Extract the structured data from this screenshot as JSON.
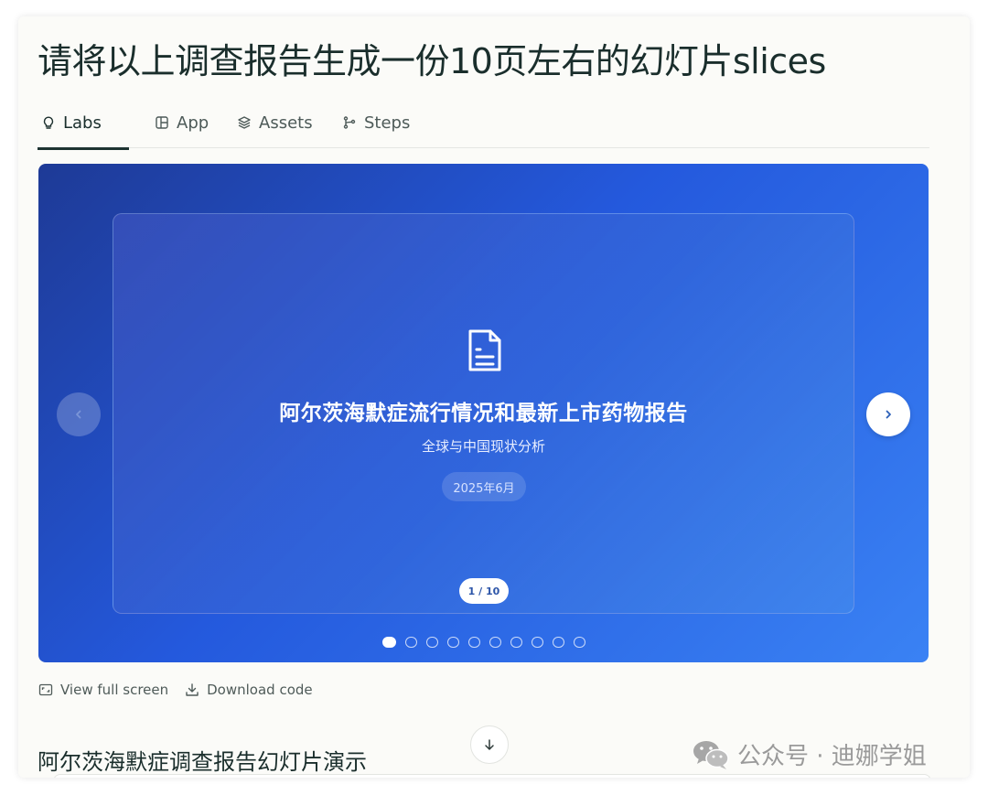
{
  "page_title": "请将以上调查报告生成一份10页左右的幻灯片slices",
  "tabs": [
    {
      "label": "Labs",
      "icon": "lightbulb-icon",
      "active": true
    },
    {
      "label": "App",
      "icon": "app-layout-icon",
      "active": false
    },
    {
      "label": "Assets",
      "icon": "layers-icon",
      "active": false
    },
    {
      "label": "Steps",
      "icon": "git-branch-icon",
      "active": false
    }
  ],
  "slide": {
    "icon": "document-icon",
    "title": "阿尔茨海默症流行情况和最新上市药物报告",
    "subtitle": "全球与中国现状分析",
    "date": "2025年6月",
    "page_indicator": "1 / 10",
    "current_index": 1,
    "total": 10
  },
  "actions": {
    "fullscreen_label": "View full screen",
    "download_label": "Download code"
  },
  "section_heading": "阿尔茨海默症调查报告幻灯片演示",
  "watermark": {
    "text": "公众号 · 迪娜学姐",
    "icon": "wechat-icon"
  },
  "colors": {
    "gradient_start": "#1e3a96",
    "gradient_mid": "#2459dd",
    "gradient_end": "#3a82f4",
    "tab_active_underline": "#1d3331"
  }
}
